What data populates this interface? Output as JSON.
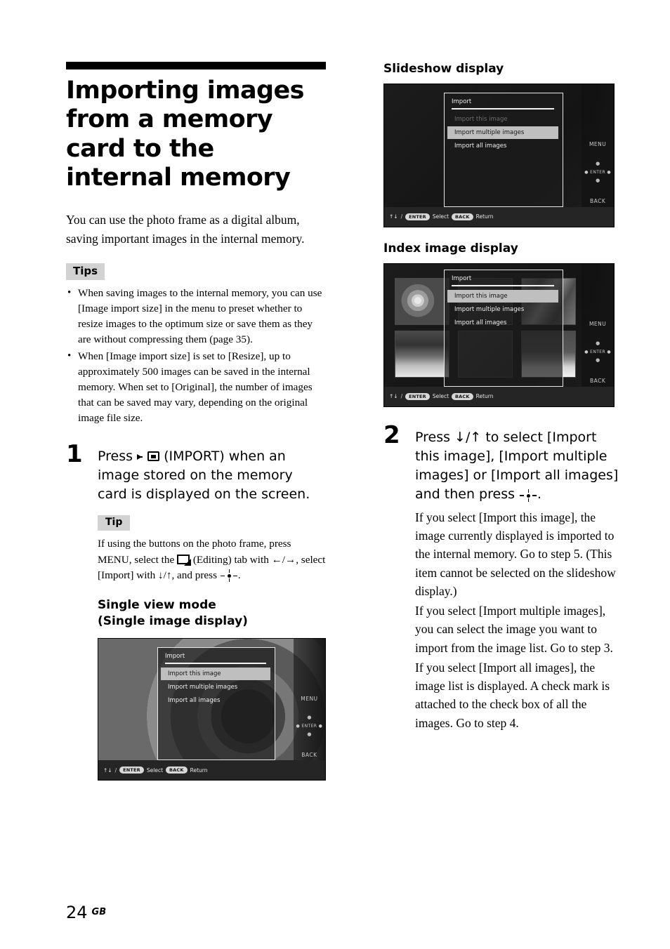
{
  "document": {
    "title": "Importing images from a memory card to the internal memory",
    "intro": "You can use the photo frame as a digital album, saving important images in the internal memory.",
    "page_number": "24",
    "page_region": "GB"
  },
  "tips_block": {
    "badge": "Tips",
    "items": [
      "When saving images to the internal memory, you can use [Image import size] in the menu to preset whether to resize images to the optimum size or save them as they are without compressing them (page 35).",
      "When [Image import size] is set to [Resize], up to approximately 500 images can be saved in the internal memory. When set to [Original], the number of images that can be saved may vary, depending on the original image file size."
    ]
  },
  "step1": {
    "number": "1",
    "lead_before_icon": "Press",
    "lead_after_icon": "(IMPORT) when an image stored on the memory card is displayed on the screen.",
    "tip": {
      "badge": "Tip",
      "part1": "If using the buttons on the photo frame, press MENU, select the",
      "part2": "(Editing) tab with ←/→, select [Import] with ↓/↑, and press",
      "part3": "."
    },
    "subhead_line1": "Single view mode",
    "subhead_line2": "(Single image display)"
  },
  "step2": {
    "number": "2",
    "lead_part1": "Press ↓/↑ to select [Import this image], [Import multiple images] or [Import all images] and then press",
    "lead_part2": ".",
    "paragraphs": [
      "If you select [Import this image], the image currently displayed is imported to the internal memory. Go to step 5. (This item cannot be selected on the slideshow display.)",
      "If you select [Import multiple images], you can select the image you want to import from the image list. Go to step 3.",
      "If you select [Import all images], the image list is displayed. A check mark is attached to the check box of all the images. Go to step 4."
    ]
  },
  "right_column": {
    "heading_slideshow": "Slideshow display",
    "heading_index": "Index image display"
  },
  "device_ui": {
    "menu_title": "Import",
    "menu_items": [
      "Import this image",
      "Import multiple images",
      "Import all images"
    ],
    "side_buttons": {
      "menu": "MENU",
      "enter": "ENTER",
      "back": "BACK"
    },
    "statusbar": {
      "arrows": "↑↓",
      "slash": "/",
      "enter_pill": "ENTER",
      "select_label": "Select",
      "back_pill": "BACK",
      "return_label": "Return"
    },
    "single_view": {
      "selected_index": 0,
      "disabled_index": -1
    },
    "slideshow_view": {
      "selected_index": 1,
      "disabled_index": 0
    },
    "index_view": {
      "selected_index": 0,
      "disabled_index": -1
    }
  },
  "colors": {
    "badge_bg": "#d2d2d2",
    "highlight": "#bfbfbf",
    "panel_border": "#e8e8e8",
    "screen_bg": "#1a1a1a"
  }
}
